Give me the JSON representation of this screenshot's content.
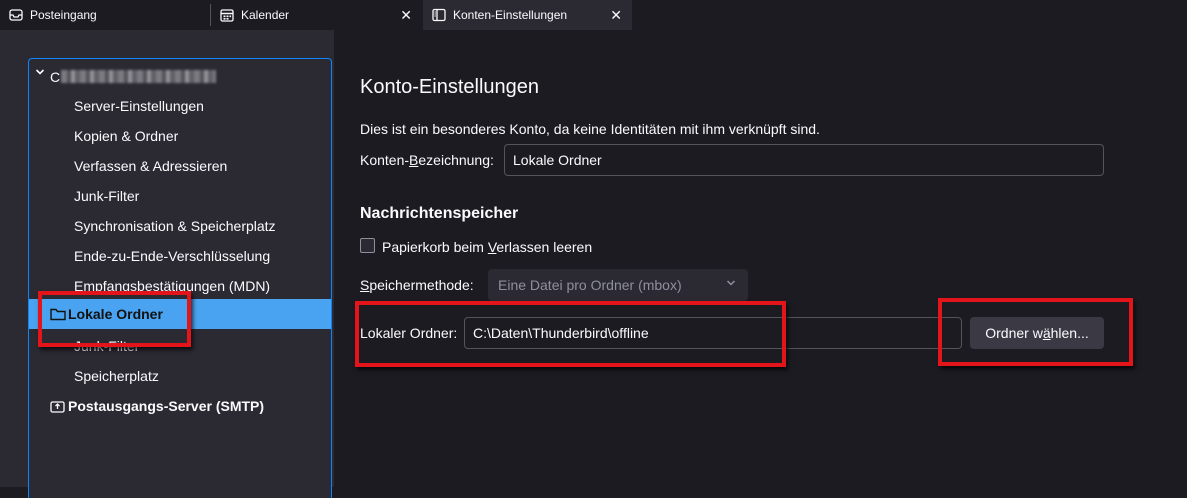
{
  "tabs": [
    {
      "label": "Posteingang",
      "icon": "inbox-icon",
      "closable": false,
      "active": false
    },
    {
      "label": "Kalender",
      "icon": "calendar-icon",
      "closable": true,
      "active": false
    },
    {
      "label": "Konten-Einstellungen",
      "icon": "account-settings-icon",
      "closable": true,
      "active": true
    }
  ],
  "sidebar": {
    "account_items": [
      {
        "label": "Server-Einstellungen"
      },
      {
        "label": "Kopien & Ordner"
      },
      {
        "label": "Verfassen & Adressieren"
      },
      {
        "label": "Junk-Filter"
      },
      {
        "label": "Synchronisation & Speicherplatz"
      },
      {
        "label": "Ende-zu-Ende-Verschlüsselung"
      },
      {
        "label": "Empfangsbestätigungen (MDN)"
      }
    ],
    "local_folders": {
      "label": "Lokale Ordner",
      "selected": true
    },
    "local_items": [
      {
        "label": "Junk-Filter"
      },
      {
        "label": "Speicherplatz"
      }
    ],
    "smtp": {
      "label": "Postausgangs-Server (SMTP)"
    }
  },
  "content": {
    "title": "Konto-Einstellungen",
    "info": "Dies ist ein besonderes Konto, da keine Identitäten mit ihm verknüpft sind.",
    "name_label_pre": "Konten-",
    "name_label_u": "B",
    "name_label_post": "ezeichnung:",
    "name_value": "Lokale Ordner",
    "section_title": "Nachrichtenspeicher",
    "trash_label_pre": "Papierkorb beim ",
    "trash_label_u": "V",
    "trash_label_post": "erlassen leeren",
    "trash_checked": false,
    "store_label_u": "S",
    "store_label_post": "peichermethode:",
    "store_value": "Eine Datei pro Ordner (mbox)",
    "local_dir_label": "Lokaler Ordner:",
    "local_dir_value": "C:\\Daten\\Thunderbird\\offline",
    "choose_btn_pre": "Ordner w",
    "choose_btn_u": "ä",
    "choose_btn_post": "hlen..."
  },
  "colors": {
    "accent": "#0a84ff",
    "selection": "#4aa3f0",
    "highlight": "#e4141b"
  }
}
